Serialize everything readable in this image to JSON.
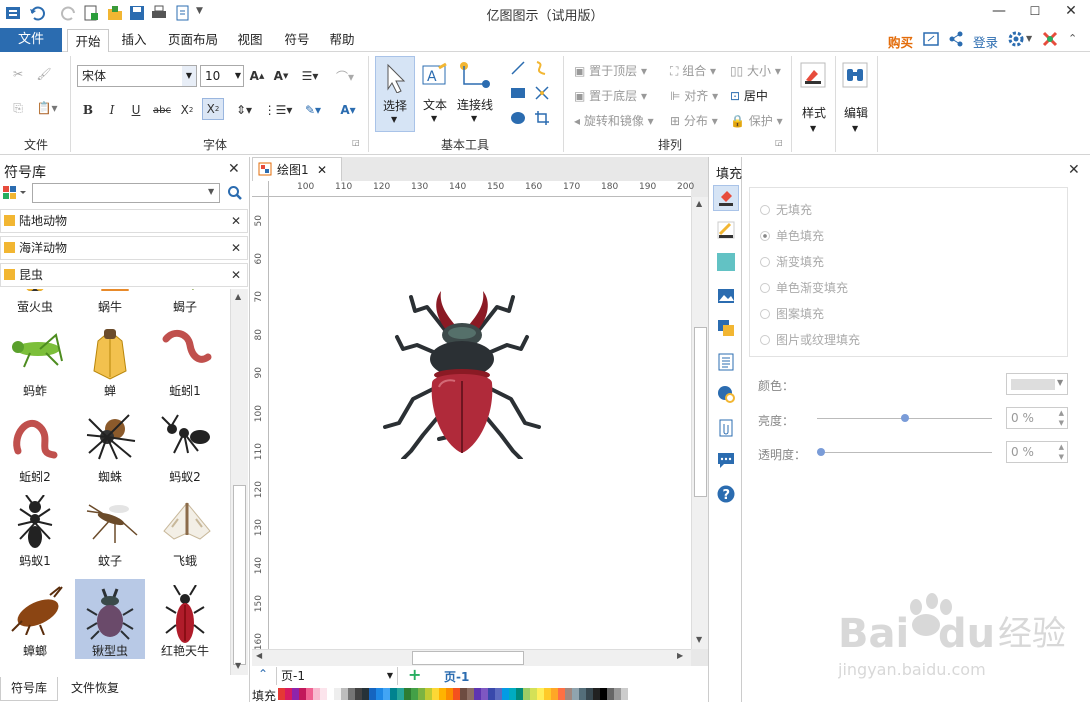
{
  "app": {
    "title": "亿图图示（试用版）"
  },
  "menu": {
    "file": "文件",
    "tabs": [
      "开始",
      "插入",
      "页面布局",
      "视图",
      "符号",
      "帮助"
    ],
    "right": {
      "buy": "购买",
      "login": "登录"
    }
  },
  "ribbon": {
    "groups": {
      "file": "文件",
      "font": "字体",
      "basic_tools": "基本工具",
      "arrange": "排列"
    },
    "font_name": "宋体",
    "font_size": "10",
    "tools": {
      "select": "选择",
      "text": "文本",
      "connector": "连接线"
    },
    "arrange": {
      "bring_top": "置于顶层",
      "send_bottom": "置于底层",
      "rotate_mirror": "旋转和镜像",
      "group": "组合",
      "align": "对齐",
      "distribute": "分布",
      "size": "大小",
      "center": "居中",
      "protect": "保护"
    },
    "style": "样式",
    "edit": "编辑"
  },
  "library": {
    "title": "符号库",
    "search_placeholder": "",
    "categories": [
      "陆地动物",
      "海洋动物",
      "昆虫"
    ],
    "symbols": [
      {
        "label": "萤火虫"
      },
      {
        "label": "蜗牛"
      },
      {
        "label": "蝎子"
      },
      {
        "label": "蚂蚱"
      },
      {
        "label": "蝉"
      },
      {
        "label": "蚯蚓1"
      },
      {
        "label": "蚯蚓2"
      },
      {
        "label": "蜘蛛"
      },
      {
        "label": "蚂蚁2"
      },
      {
        "label": "蚂蚁1"
      },
      {
        "label": "蚊子"
      },
      {
        "label": "飞蛾"
      },
      {
        "label": "蟑螂"
      },
      {
        "label": "锹型虫"
      },
      {
        "label": "红艳天牛"
      }
    ],
    "selected": "锹型虫",
    "bottom_tabs": [
      "符号库",
      "文件恢复"
    ]
  },
  "document": {
    "tab": "绘图1",
    "ruler_h": [
      "100",
      "110",
      "120",
      "130",
      "140",
      "150",
      "160",
      "170",
      "180",
      "190",
      "200"
    ],
    "ruler_v": [
      "50",
      "60",
      "70",
      "80",
      "90",
      "100",
      "110",
      "120",
      "130",
      "140",
      "150",
      "160"
    ],
    "page_select": "页-1",
    "page_tab": "页-1",
    "fill_label": "填充"
  },
  "fill": {
    "title": "填充",
    "options": [
      "无填充",
      "单色填充",
      "渐变填充",
      "单色渐变填充",
      "图案填充",
      "图片或纹理填充"
    ],
    "selected": "单色填充",
    "color_label": "颜色：",
    "brightness_label": "亮度：",
    "brightness_value": "0 %",
    "transparency_label": "透明度：",
    "transparency_value": "0 %",
    "brightness_level": 0.5,
    "transparency_level": 0.0
  },
  "watermark": {
    "brand": "Baidu经验",
    "url": "jingyan.baidu.com"
  },
  "colors": {
    "accent": "#2b6cb0",
    "beetle_body": "#b02a3a",
    "beetle_dark": "#2b3034",
    "buy": "#e36c0a"
  }
}
